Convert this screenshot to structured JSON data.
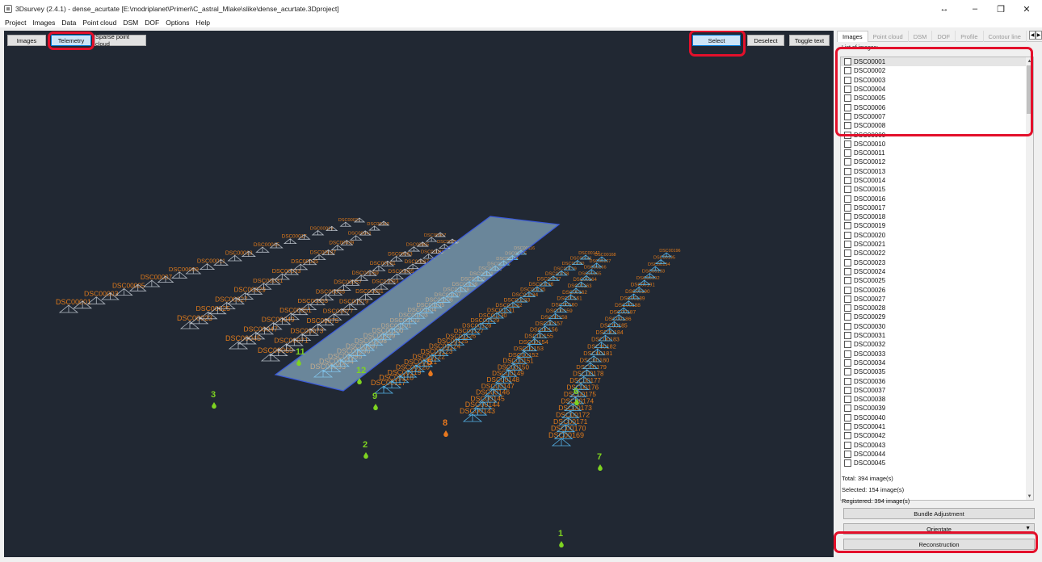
{
  "window": {
    "title": "3Dsurvey (2.4.1) - dense_acurtate [E:\\modriplanet\\Primeri\\C_astral_Mlake\\slike\\dense_acurtate.3Dproject]",
    "controls": [
      "↔",
      "–",
      "❐",
      "✕"
    ]
  },
  "menu": [
    "Project",
    "Images",
    "Data",
    "Point cloud",
    "DSM",
    "DOF",
    "Options",
    "Help"
  ],
  "viewport": {
    "left_buttons": [
      "Images",
      "Telemetry",
      "Sparse point cloud"
    ],
    "right_buttons": [
      "Select",
      "Deselect",
      "Toggle text"
    ],
    "active_buttons": [
      "Telemetry",
      "Select"
    ],
    "gcp_markers": [
      {
        "label": "1",
        "color": "green"
      },
      {
        "label": "2",
        "color": "green"
      },
      {
        "label": "3",
        "color": "green"
      },
      {
        "label": "5",
        "color": "orange"
      },
      {
        "label": "6",
        "color": "green"
      },
      {
        "label": "7",
        "color": "green"
      },
      {
        "label": "8",
        "color": "orange"
      },
      {
        "label": "9",
        "color": "green"
      },
      {
        "label": "11",
        "color": "green"
      },
      {
        "label": "12",
        "color": "green"
      }
    ],
    "camera_label_prefix": "DSC00",
    "colors": {
      "background": "#212833",
      "unselected": "#e07a1a",
      "selected": "#56b4e9",
      "gcp_green": "#7ed321",
      "gcp_orange": "#e8781e",
      "selection_rect": "#a8d4ef"
    }
  },
  "panel": {
    "tabs": [
      "Images",
      "Point cloud",
      "DSM",
      "DOF",
      "Profile",
      "Contour line"
    ],
    "active_tab": "Images",
    "list_label": "List of images:",
    "images": [
      "DSC00001",
      "DSC00002",
      "DSC00003",
      "DSC00004",
      "DSC00005",
      "DSC00006",
      "DSC00007",
      "DSC00008",
      "DSC00009",
      "DSC00010",
      "DSC00011",
      "DSC00012",
      "DSC00013",
      "DSC00014",
      "DSC00015",
      "DSC00016",
      "DSC00017",
      "DSC00018",
      "DSC00019",
      "DSC00020",
      "DSC00021",
      "DSC00022",
      "DSC00023",
      "DSC00024",
      "DSC00025",
      "DSC00026",
      "DSC00027",
      "DSC00028",
      "DSC00029",
      "DSC00030",
      "DSC00031",
      "DSC00032",
      "DSC00033",
      "DSC00034",
      "DSC00035",
      "DSC00036",
      "DSC00037",
      "DSC00038",
      "DSC00039",
      "DSC00040",
      "DSC00041",
      "DSC00042",
      "DSC00043",
      "DSC00044",
      "DSC00045"
    ],
    "total": "Total: 394 image(s)",
    "selected": "Selected: 154 image(s)",
    "registered": "Registered: 394 image(s)",
    "bundle_button": "Bundle Adjustment",
    "orientate_combo": "Orientate",
    "reconstruction_button": "Reconstruction"
  }
}
